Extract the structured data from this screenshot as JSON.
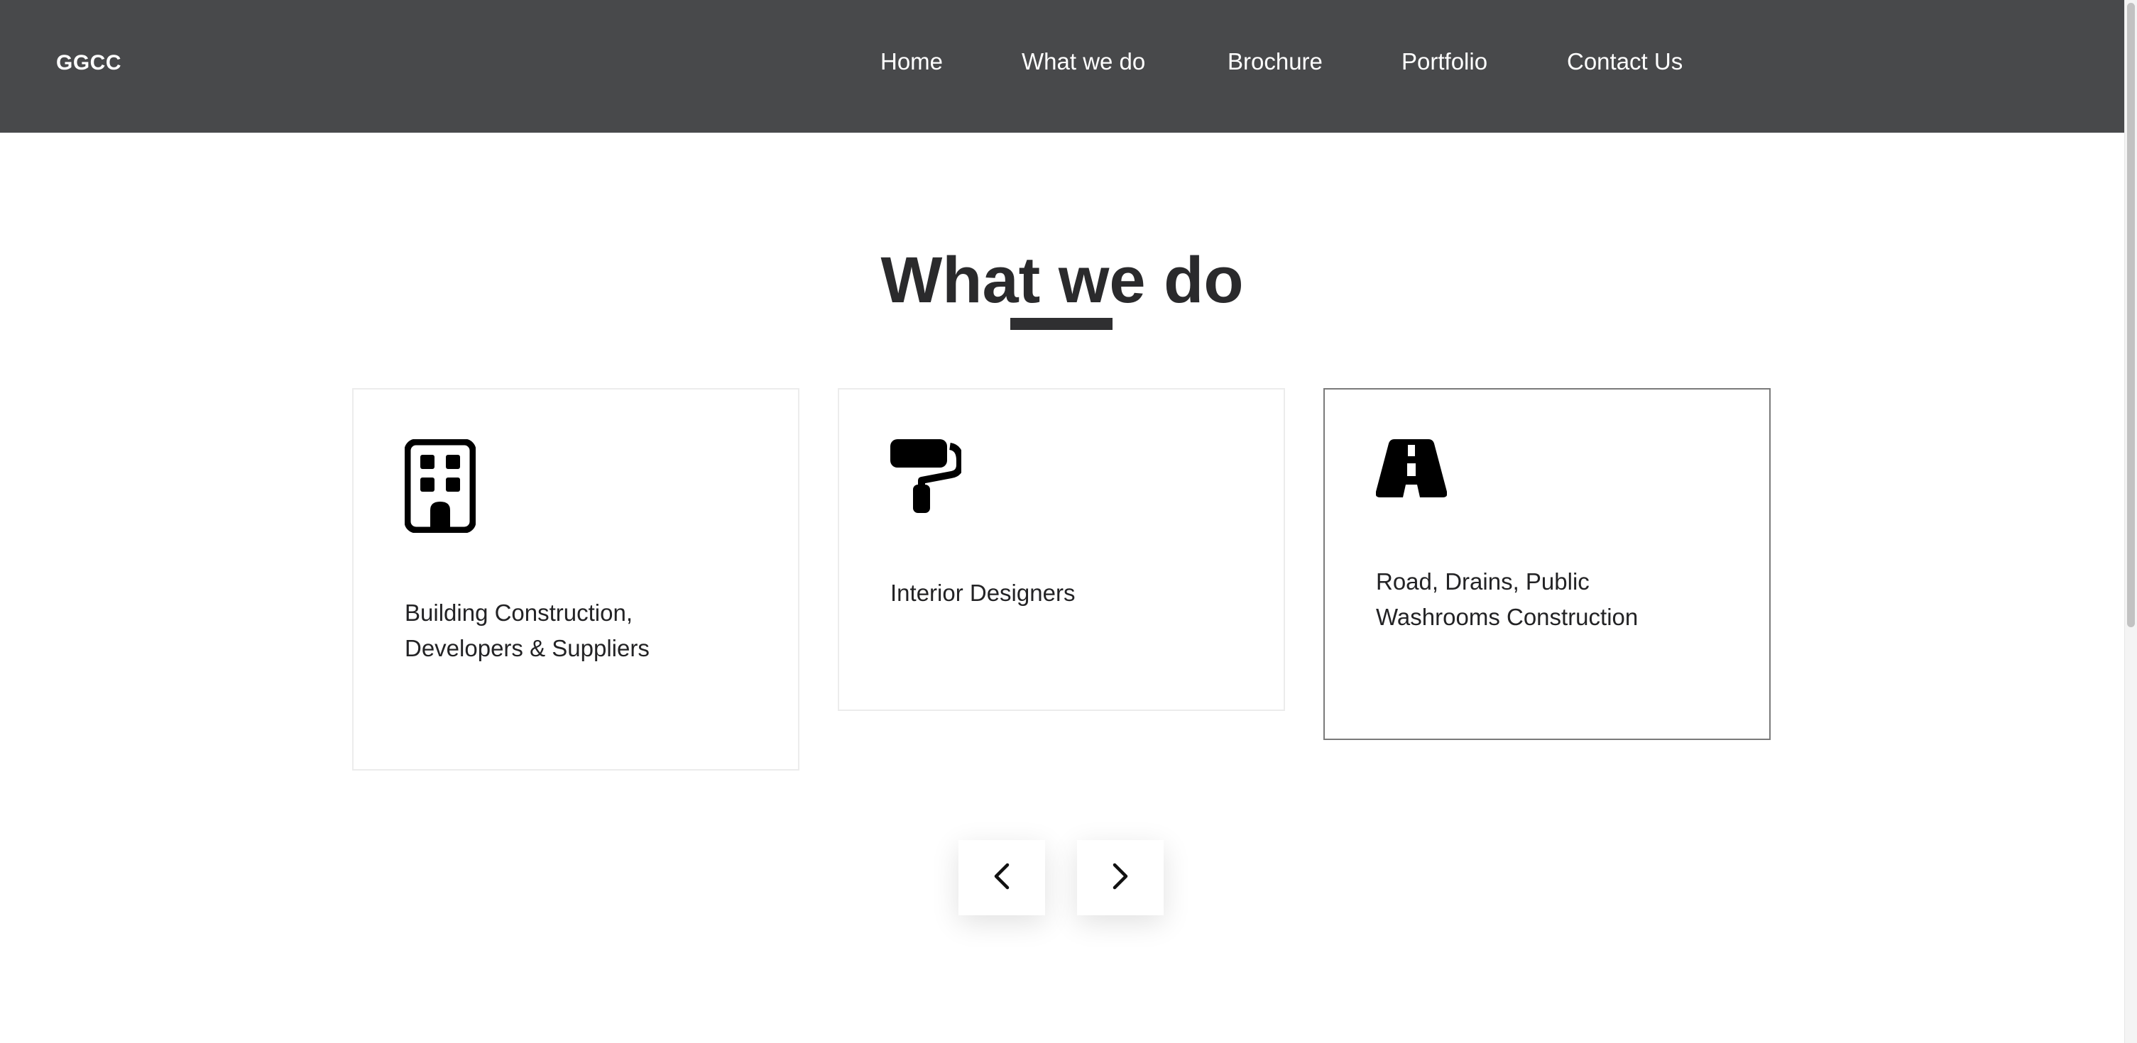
{
  "header": {
    "brand": "GGCC",
    "nav": {
      "home": "Home",
      "what_we_do": "What we do",
      "brochure": "Brochure",
      "portfolio": "Portfolio",
      "contact_us": "Contact Us"
    },
    "background_color": "#48494b"
  },
  "section": {
    "title": "What we do",
    "cards": [
      {
        "icon": "building-icon",
        "text": "Building Construction, Developers & Suppliers"
      },
      {
        "icon": "paint-roller-icon",
        "text": "Interior Designers"
      },
      {
        "icon": "road-icon",
        "text": "Road, Drains, Public Washrooms Construction"
      }
    ]
  },
  "slider": {
    "prev_icon": "chevron-left-icon",
    "next_icon": "chevron-right-icon"
  }
}
